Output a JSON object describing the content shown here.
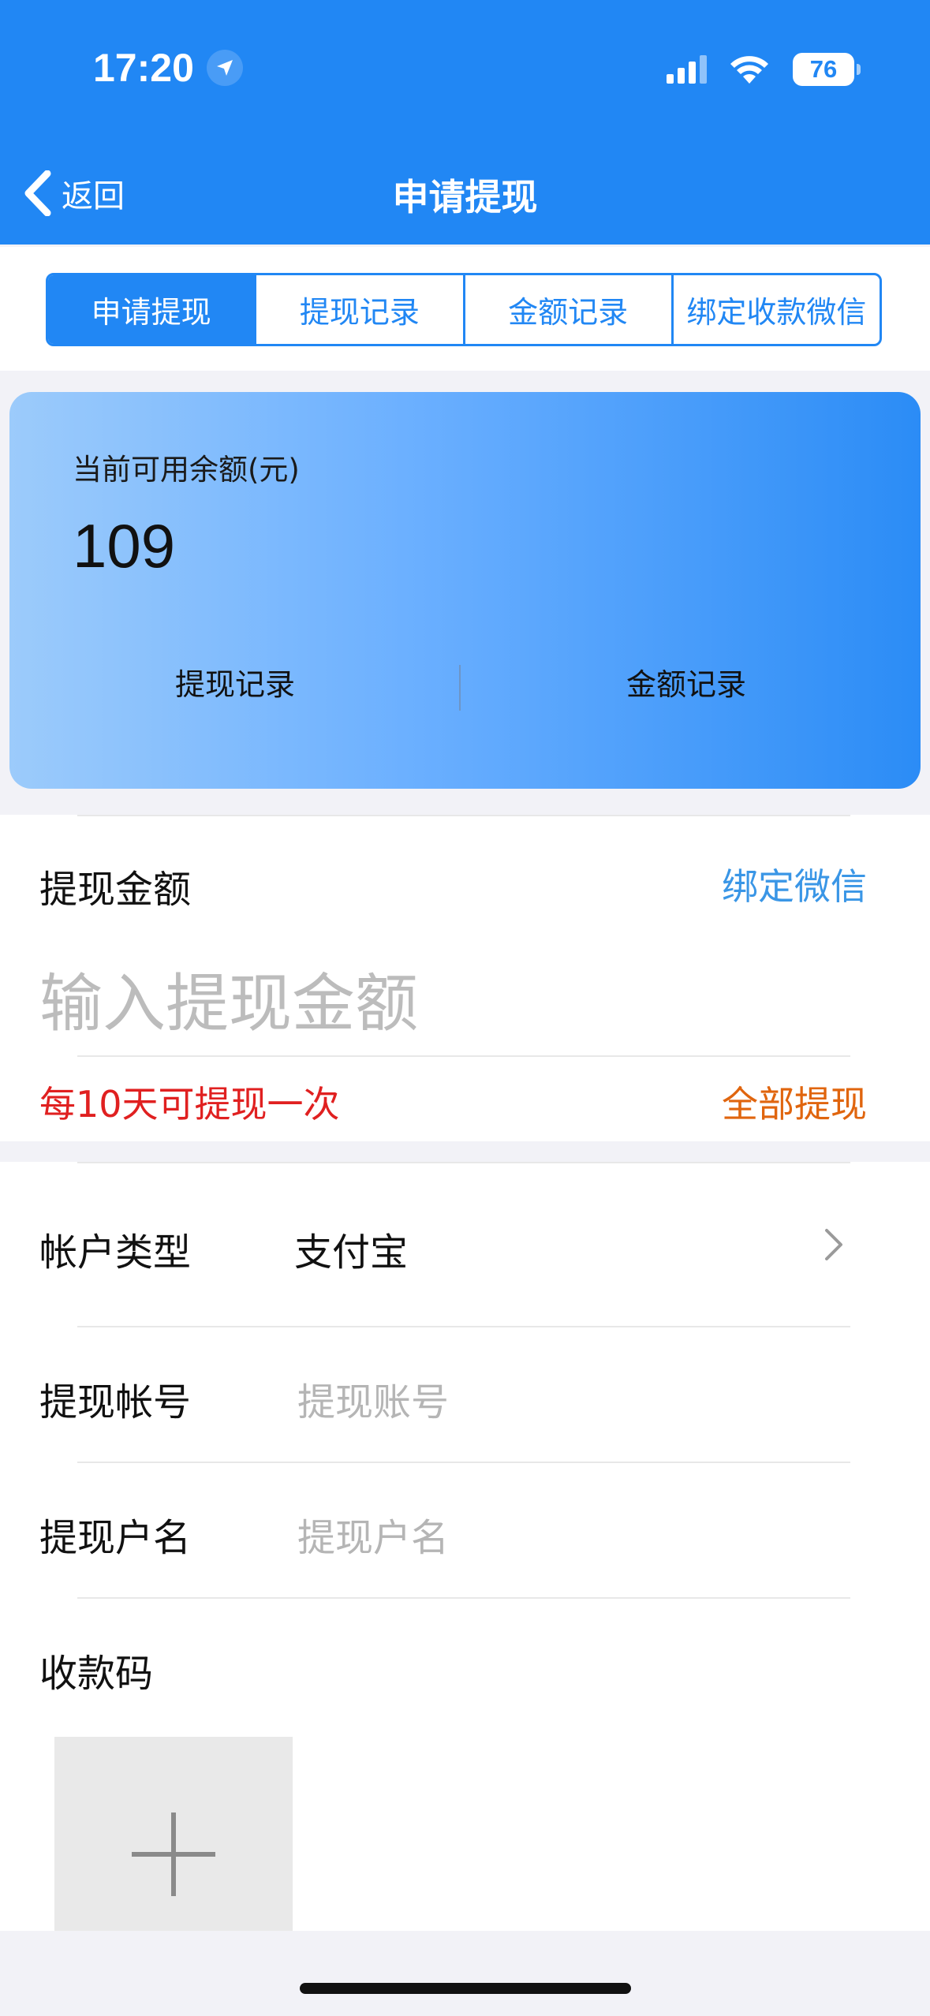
{
  "status_bar": {
    "time": "17:20",
    "battery": "76"
  },
  "nav": {
    "back_label": "返回",
    "title": "申请提现"
  },
  "tabs": [
    {
      "label": "申请提现",
      "active": true
    },
    {
      "label": "提现记录",
      "active": false
    },
    {
      "label": "金额记录",
      "active": false
    },
    {
      "label": "绑定收款微信",
      "active": false
    }
  ],
  "balance_card": {
    "label": "当前可用余额(元)",
    "amount": "109",
    "link_left": "提现记录",
    "link_right": "金额记录"
  },
  "withdraw": {
    "label": "提现金额",
    "bind_link": "绑定微信",
    "amount_placeholder": "输入提现金额",
    "note": "每10天可提现一次",
    "withdraw_all": "全部提现"
  },
  "account": {
    "type_label": "帐户类型",
    "type_value": "支付宝",
    "number_label": "提现帐号",
    "number_placeholder": "提现账号",
    "name_label": "提现户名",
    "name_placeholder": "提现户名",
    "qr_label": "收款码"
  },
  "colors": {
    "primary": "#2187f4",
    "red_note": "#e02020",
    "orange_link": "#e0650e",
    "link_blue": "#3a96e6"
  },
  "icons": [
    "location-arrow-icon",
    "signal-icon",
    "wifi-icon",
    "battery-icon",
    "back-chevron-icon",
    "chevron-right-icon",
    "plus-icon"
  ]
}
